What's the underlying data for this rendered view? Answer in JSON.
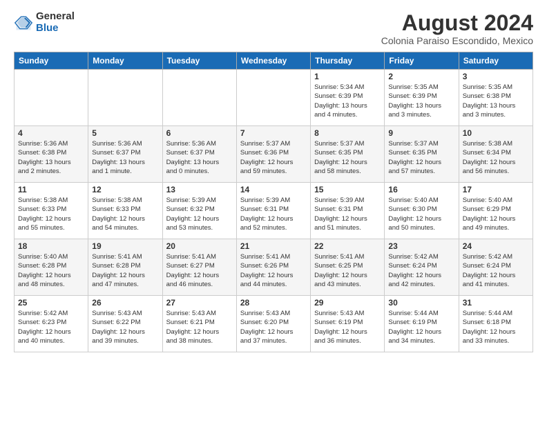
{
  "logo": {
    "general": "General",
    "blue": "Blue"
  },
  "title": "August 2024",
  "subtitle": "Colonia Paraiso Escondido, Mexico",
  "days_header": [
    "Sunday",
    "Monday",
    "Tuesday",
    "Wednesday",
    "Thursday",
    "Friday",
    "Saturday"
  ],
  "weeks": [
    [
      {
        "day": "",
        "info": ""
      },
      {
        "day": "",
        "info": ""
      },
      {
        "day": "",
        "info": ""
      },
      {
        "day": "",
        "info": ""
      },
      {
        "day": "1",
        "info": "Sunrise: 5:34 AM\nSunset: 6:39 PM\nDaylight: 13 hours\nand 4 minutes."
      },
      {
        "day": "2",
        "info": "Sunrise: 5:35 AM\nSunset: 6:39 PM\nDaylight: 13 hours\nand 3 minutes."
      },
      {
        "day": "3",
        "info": "Sunrise: 5:35 AM\nSunset: 6:38 PM\nDaylight: 13 hours\nand 3 minutes."
      }
    ],
    [
      {
        "day": "4",
        "info": "Sunrise: 5:36 AM\nSunset: 6:38 PM\nDaylight: 13 hours\nand 2 minutes."
      },
      {
        "day": "5",
        "info": "Sunrise: 5:36 AM\nSunset: 6:37 PM\nDaylight: 13 hours\nand 1 minute."
      },
      {
        "day": "6",
        "info": "Sunrise: 5:36 AM\nSunset: 6:37 PM\nDaylight: 13 hours\nand 0 minutes."
      },
      {
        "day": "7",
        "info": "Sunrise: 5:37 AM\nSunset: 6:36 PM\nDaylight: 12 hours\nand 59 minutes."
      },
      {
        "day": "8",
        "info": "Sunrise: 5:37 AM\nSunset: 6:35 PM\nDaylight: 12 hours\nand 58 minutes."
      },
      {
        "day": "9",
        "info": "Sunrise: 5:37 AM\nSunset: 6:35 PM\nDaylight: 12 hours\nand 57 minutes."
      },
      {
        "day": "10",
        "info": "Sunrise: 5:38 AM\nSunset: 6:34 PM\nDaylight: 12 hours\nand 56 minutes."
      }
    ],
    [
      {
        "day": "11",
        "info": "Sunrise: 5:38 AM\nSunset: 6:33 PM\nDaylight: 12 hours\nand 55 minutes."
      },
      {
        "day": "12",
        "info": "Sunrise: 5:38 AM\nSunset: 6:33 PM\nDaylight: 12 hours\nand 54 minutes."
      },
      {
        "day": "13",
        "info": "Sunrise: 5:39 AM\nSunset: 6:32 PM\nDaylight: 12 hours\nand 53 minutes."
      },
      {
        "day": "14",
        "info": "Sunrise: 5:39 AM\nSunset: 6:31 PM\nDaylight: 12 hours\nand 52 minutes."
      },
      {
        "day": "15",
        "info": "Sunrise: 5:39 AM\nSunset: 6:31 PM\nDaylight: 12 hours\nand 51 minutes."
      },
      {
        "day": "16",
        "info": "Sunrise: 5:40 AM\nSunset: 6:30 PM\nDaylight: 12 hours\nand 50 minutes."
      },
      {
        "day": "17",
        "info": "Sunrise: 5:40 AM\nSunset: 6:29 PM\nDaylight: 12 hours\nand 49 minutes."
      }
    ],
    [
      {
        "day": "18",
        "info": "Sunrise: 5:40 AM\nSunset: 6:28 PM\nDaylight: 12 hours\nand 48 minutes."
      },
      {
        "day": "19",
        "info": "Sunrise: 5:41 AM\nSunset: 6:28 PM\nDaylight: 12 hours\nand 47 minutes."
      },
      {
        "day": "20",
        "info": "Sunrise: 5:41 AM\nSunset: 6:27 PM\nDaylight: 12 hours\nand 46 minutes."
      },
      {
        "day": "21",
        "info": "Sunrise: 5:41 AM\nSunset: 6:26 PM\nDaylight: 12 hours\nand 44 minutes."
      },
      {
        "day": "22",
        "info": "Sunrise: 5:41 AM\nSunset: 6:25 PM\nDaylight: 12 hours\nand 43 minutes."
      },
      {
        "day": "23",
        "info": "Sunrise: 5:42 AM\nSunset: 6:24 PM\nDaylight: 12 hours\nand 42 minutes."
      },
      {
        "day": "24",
        "info": "Sunrise: 5:42 AM\nSunset: 6:24 PM\nDaylight: 12 hours\nand 41 minutes."
      }
    ],
    [
      {
        "day": "25",
        "info": "Sunrise: 5:42 AM\nSunset: 6:23 PM\nDaylight: 12 hours\nand 40 minutes."
      },
      {
        "day": "26",
        "info": "Sunrise: 5:43 AM\nSunset: 6:22 PM\nDaylight: 12 hours\nand 39 minutes."
      },
      {
        "day": "27",
        "info": "Sunrise: 5:43 AM\nSunset: 6:21 PM\nDaylight: 12 hours\nand 38 minutes."
      },
      {
        "day": "28",
        "info": "Sunrise: 5:43 AM\nSunset: 6:20 PM\nDaylight: 12 hours\nand 37 minutes."
      },
      {
        "day": "29",
        "info": "Sunrise: 5:43 AM\nSunset: 6:19 PM\nDaylight: 12 hours\nand 36 minutes."
      },
      {
        "day": "30",
        "info": "Sunrise: 5:44 AM\nSunset: 6:19 PM\nDaylight: 12 hours\nand 34 minutes."
      },
      {
        "day": "31",
        "info": "Sunrise: 5:44 AM\nSunset: 6:18 PM\nDaylight: 12 hours\nand 33 minutes."
      }
    ]
  ]
}
